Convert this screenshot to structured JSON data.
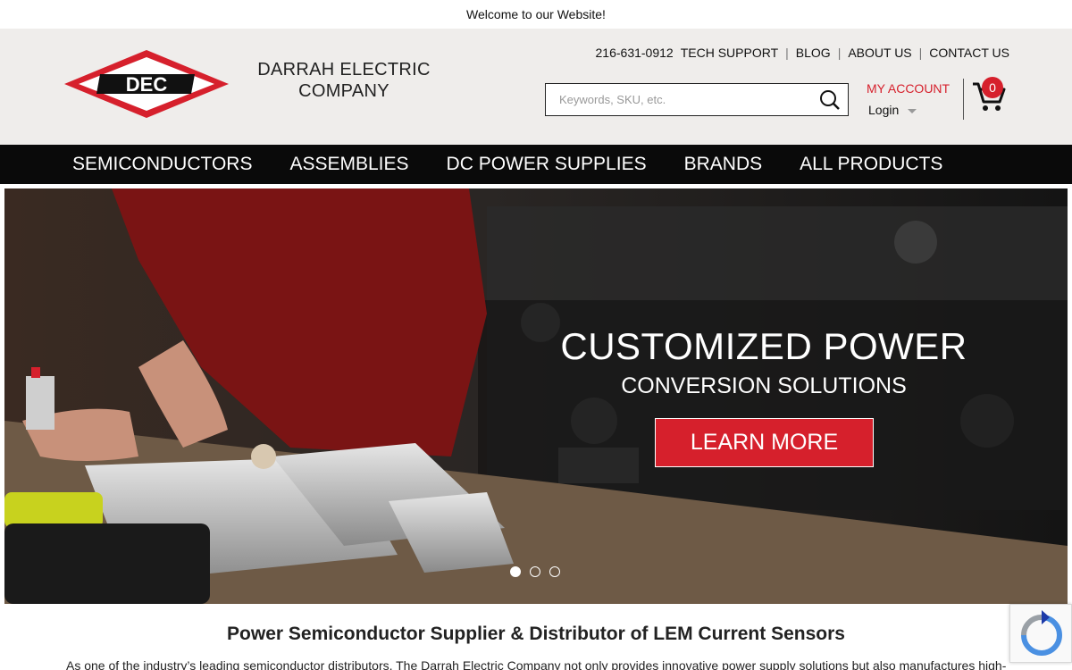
{
  "welcome": "Welcome to our Website!",
  "logo": {
    "text": "DEC"
  },
  "company": {
    "name_line1": "DARRAH ELECTRIC",
    "name_line2": "COMPANY"
  },
  "top_links": {
    "phone": "216-631-0912",
    "tech_support": "TECH SUPPORT",
    "blog": "BLOG",
    "about": "ABOUT US",
    "contact": "CONTACT US",
    "separator": "|"
  },
  "search": {
    "placeholder": "Keywords, SKU, etc.",
    "icon": "search-icon"
  },
  "account": {
    "my_account": "MY ACCOUNT",
    "login": "Login"
  },
  "cart": {
    "count": "0",
    "icon": "cart-icon"
  },
  "nav": {
    "items": [
      {
        "label": "SEMICONDUCTORS"
      },
      {
        "label": "ASSEMBLIES"
      },
      {
        "label": "DC POWER SUPPLIES"
      },
      {
        "label": "BRANDS"
      },
      {
        "label": "ALL PRODUCTS"
      }
    ]
  },
  "hero": {
    "title": "CUSTOMIZED POWER",
    "subtitle": "CONVERSION SOLUTIONS",
    "button": "LEARN MORE",
    "slides": 3,
    "active_slide": 1
  },
  "intro": {
    "title": "Power Semiconductor Supplier & Distributor of LEM Current Sensors",
    "text": "As one of the industry’s leading semiconductor distributors, The Darrah Electric Company not only provides innovative power supply solutions but also manufactures high-"
  },
  "colors": {
    "accent": "#d6202c",
    "nav_bg": "#0a0a0a",
    "header_bg": "#efedeb"
  }
}
